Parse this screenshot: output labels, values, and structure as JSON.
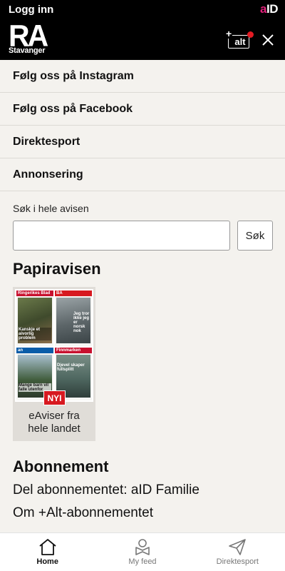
{
  "topbar": {
    "login": "Logg inn",
    "aid_a": "a",
    "aid_id": "ID"
  },
  "header": {
    "logo_main": "RA",
    "logo_city": "Stavanger",
    "plus_alt": "alt",
    "plus_sign": "+"
  },
  "menu": {
    "items": [
      "Følg oss på Instagram",
      "Følg oss på Facebook",
      "Direktesport",
      "Annonsering"
    ]
  },
  "search": {
    "label": "Søk i hele avisen",
    "value": "",
    "placeholder": "",
    "button": "Søk"
  },
  "paper": {
    "title": "Papiravisen",
    "badge": "NYI",
    "card_label_line1": "eAviser fra",
    "card_label_line2": "hele landet",
    "covers": [
      {
        "masthead": "Ringerikes Blad",
        "headline": "Kanskje et aivorlig problem"
      },
      {
        "masthead": "BA",
        "headline": "Jeg tror ikke jeg er norsk nok"
      },
      {
        "masthead": "an",
        "headline": "Mange barn vil falle utenfor"
      },
      {
        "masthead": "Finnmarken",
        "headline": "Djevel skaper fullsplitt"
      }
    ]
  },
  "subscription": {
    "title": "Abonnement",
    "links": [
      "Del abonnementet: aID Familie",
      "Om +Alt-abonnementet"
    ]
  },
  "bottom_nav": {
    "items": [
      {
        "label": "Home",
        "icon": "home-icon",
        "active": true
      },
      {
        "label": "My feed",
        "icon": "user-feed-icon",
        "active": false
      },
      {
        "label": "Direktesport",
        "icon": "paper-plane-icon",
        "active": false
      }
    ]
  },
  "colors": {
    "accent_red": "#e31b23",
    "aid_pink": "#e0207a",
    "background": "#f4f2ee"
  }
}
